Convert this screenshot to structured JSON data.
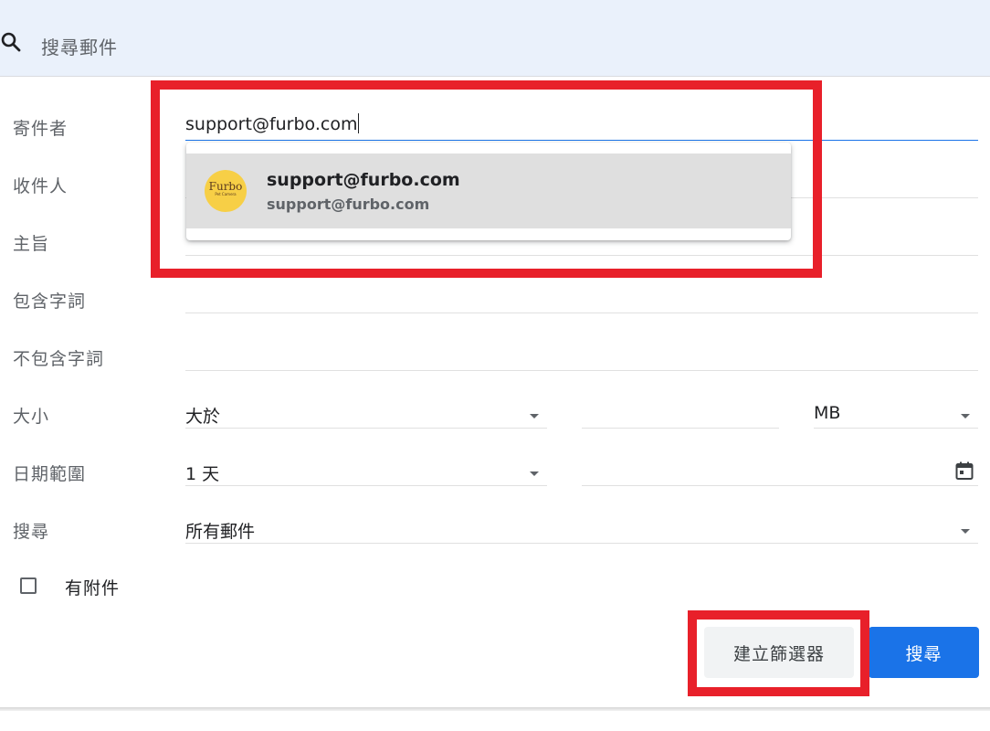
{
  "search": {
    "placeholder": "搜尋郵件"
  },
  "form": {
    "from_label": "寄件者",
    "from_value": "support@furbo.com",
    "to_label": "收件人",
    "subject_label": "主旨",
    "has_words_label": "包含字詞",
    "not_words_label": "不包含字詞",
    "size_label": "大小",
    "size_operator": "大於",
    "size_unit": "MB",
    "date_label": "日期範圍",
    "date_range": "1 天",
    "search_in_label": "搜尋",
    "search_in_value": "所有郵件",
    "has_attachment_label": "有附件"
  },
  "suggestion": {
    "name": "support@furbo.com",
    "email": "support@furbo.com",
    "avatar_brand": "Furbo",
    "avatar_tag": "Pet Camera"
  },
  "buttons": {
    "create_filter": "建立篩選器",
    "search": "搜尋"
  },
  "colors": {
    "accent": "#1a73e8",
    "highlight": "#e8202a",
    "avatar": "#f7cf46",
    "header_bg": "#eaf1fb"
  }
}
